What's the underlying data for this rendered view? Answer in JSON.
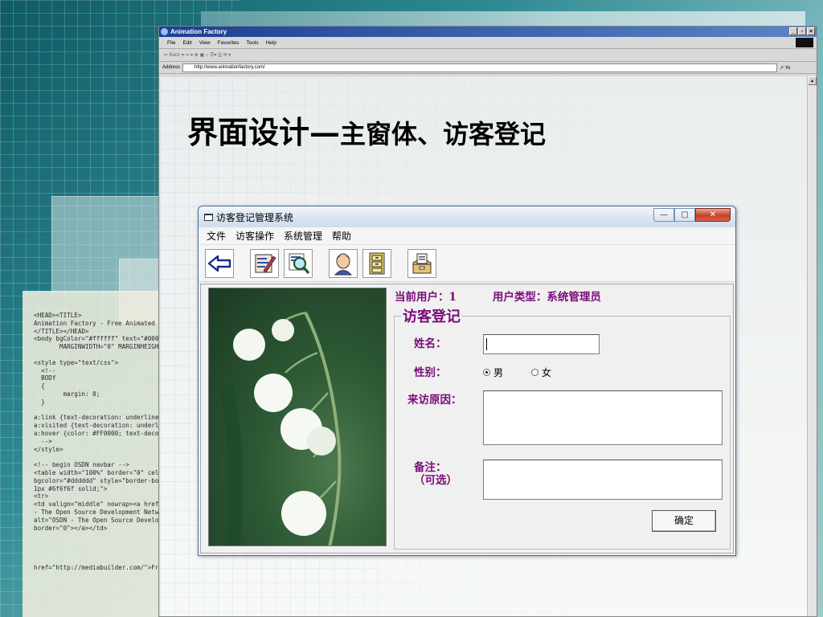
{
  "browser": {
    "title": "Animation Factory",
    "menu": [
      "File",
      "Edit",
      "View",
      "Favorites",
      "Tools",
      "Help"
    ],
    "toolbar_text": "⇐ Back ▾ ⇒ ▾ ⊗ ▣ ⌂   ☰▾ ⎙ ✉ ▾",
    "address_label": "Address",
    "address_url": "http://www.animationfactory.com/",
    "go_label": "↗ Yo"
  },
  "background_code": "<HEAD><TITLE>\nAnimation Factory - Free Animated Clipa\n</TITLE></HEAD>\n<body bgColor=\"#ffffff\" text=\"#000000\"\n       MARGINWIDTH=\"0\" MARGINHEIGHT=\"0\"\n\n<style type=\"text/css\">\n  <!--\n  BODY\n  {\n        margin: 0;\n  }\n\na:link {text-decoration: underline}\na:visited {text-decoration: underline}\na:hover {color: #FF0000; text-decoration\n  -->\n</style>\n\n<!-- begin OSDN navbar -->\n<table width=\"100%\" border=\"0\" cellpadd\nbgcolor=\"#dddddd\" style=\"border-bottom: \n1px #6f6f6f solid;\">\n<tr>\n<td valign=\"middle\" nowrap><a href=\"http\n- The Open Source Development Network \nalt=\"OSDN - The Open Source Development\nborder=\"0\"></a></td>\n\n\n\n\nhref=\"http://mediabuilder.com/\">Fre",
  "slide": {
    "title_big": "界面设计—",
    "title_small": "主窗体、访客登记"
  },
  "app": {
    "window_title": "访客登记管理系统",
    "menu": [
      "文件",
      "访客操作",
      "系统管理",
      "帮助"
    ],
    "current_user": "当前用户：1",
    "user_type": "用户类型：系统管理员",
    "group_title": "访客登记",
    "name_label": "姓名：",
    "gender_label": "性别：",
    "gender_male": "男",
    "gender_female": "女",
    "gender_selected": "男",
    "reason_label": "来访原因：",
    "notes_label": "备注：",
    "notes_optional": "（可选）",
    "ok_button": "确定",
    "name_value": "",
    "reason_value": "",
    "notes_value": ""
  }
}
